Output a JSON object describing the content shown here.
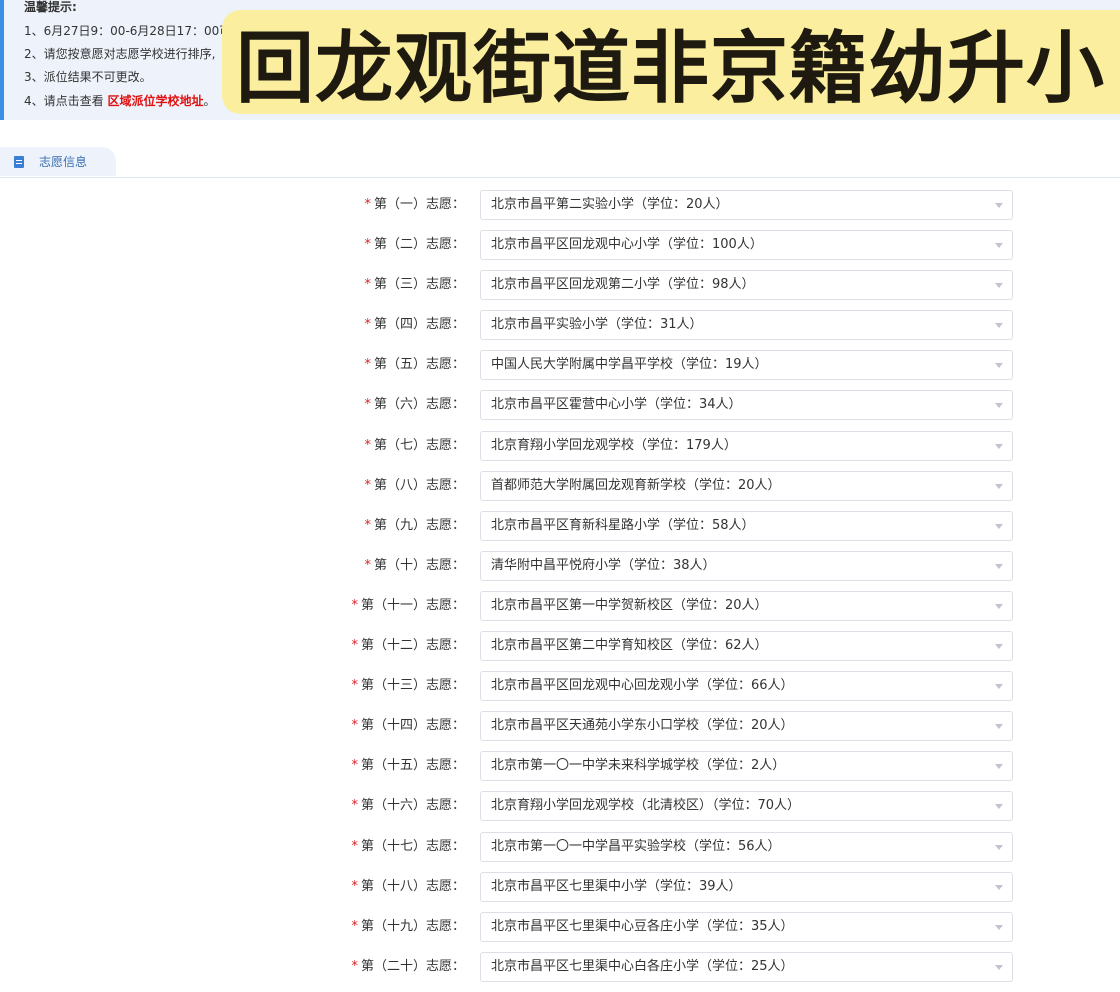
{
  "notice": {
    "title": "温馨提示:",
    "line1": "1、6月27日9：00-6月28日17：00可",
    "line2": "2、请您按意愿对志愿学校进行排序,",
    "line3": "3、派位结果不可更改。",
    "line4_prefix": "4、请点击查看 ",
    "line4_link": "区域派位学校地址",
    "line4_suffix": "。"
  },
  "banner": {
    "text": "回龙观街道非京籍幼升小"
  },
  "tab": {
    "label": "志愿信息",
    "icon": "document-icon"
  },
  "colors": {
    "accent": "#3a8ee6",
    "required": "#e02020",
    "link": "#e01010",
    "banner_bg": "#fbef9f"
  },
  "choices": [
    {
      "label": "第（一）志愿：",
      "value": "北京市昌平第二实验小学（学位：20人）"
    },
    {
      "label": "第（二）志愿：",
      "value": "北京市昌平区回龙观中心小学（学位：100人）"
    },
    {
      "label": "第（三）志愿：",
      "value": "北京市昌平区回龙观第二小学（学位：98人）"
    },
    {
      "label": "第（四）志愿：",
      "value": "北京市昌平实验小学（学位：31人）"
    },
    {
      "label": "第（五）志愿：",
      "value": "中国人民大学附属中学昌平学校（学位：19人）"
    },
    {
      "label": "第（六）志愿：",
      "value": "北京市昌平区霍营中心小学（学位：34人）"
    },
    {
      "label": "第（七）志愿：",
      "value": "北京育翔小学回龙观学校（学位：179人）"
    },
    {
      "label": "第（八）志愿：",
      "value": "首都师范大学附属回龙观育新学校（学位：20人）"
    },
    {
      "label": "第（九）志愿：",
      "value": "北京市昌平区育新科星路小学（学位：58人）"
    },
    {
      "label": "第（十）志愿：",
      "value": "清华附中昌平悦府小学（学位：38人）"
    },
    {
      "label": "第（十一）志愿：",
      "value": "北京市昌平区第一中学贺新校区（学位：20人）"
    },
    {
      "label": "第（十二）志愿：",
      "value": "北京市昌平区第二中学育知校区（学位：62人）"
    },
    {
      "label": "第（十三）志愿：",
      "value": "北京市昌平区回龙观中心回龙观小学（学位：66人）"
    },
    {
      "label": "第（十四）志愿：",
      "value": "北京市昌平区天通苑小学东小口学校（学位：20人）"
    },
    {
      "label": "第（十五）志愿：",
      "value": "北京市第一〇一中学未来科学城学校（学位：2人）"
    },
    {
      "label": "第（十六）志愿：",
      "value": "北京育翔小学回龙观学校（北清校区）（学位：70人）"
    },
    {
      "label": "第（十七）志愿：",
      "value": "北京市第一〇一中学昌平实验学校（学位：56人）"
    },
    {
      "label": "第（十八）志愿：",
      "value": "北京市昌平区七里渠中小学（学位：39人）"
    },
    {
      "label": "第（十九）志愿：",
      "value": "北京市昌平区七里渠中心豆各庄小学（学位：35人）"
    },
    {
      "label": "第（二十）志愿：",
      "value": "北京市昌平区七里渠中心白各庄小学（学位：25人）"
    }
  ]
}
